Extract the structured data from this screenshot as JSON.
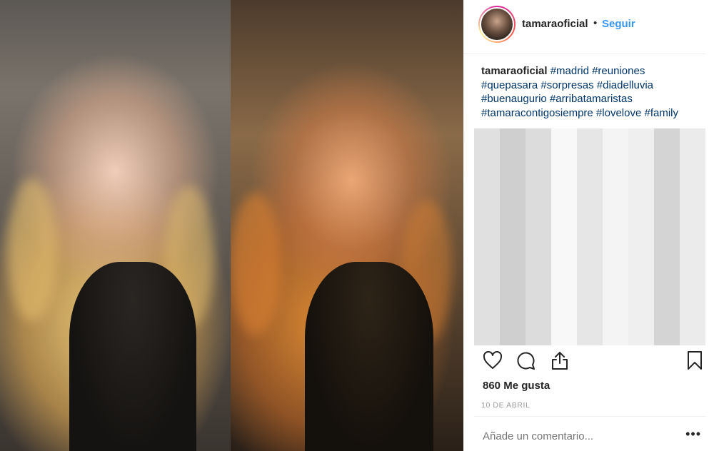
{
  "post": {
    "username": "tamaraoficial",
    "follow_separator": "•",
    "follow_label": "Seguir",
    "caption_user": "tamaraoficial",
    "hashtags": [
      "#madrid",
      "#reuniones",
      "#quepasara",
      "#sorpresas",
      "#diadelluvia",
      "#buenaugurio",
      "#arribatamaristas",
      "#tamaracontigosiempre",
      "#lovelove",
      "#family"
    ],
    "likes": "860 Me gusta",
    "date": "10 DE ABRIL",
    "comment_placeholder": "Añade un comentario...",
    "more_label": "•••"
  },
  "icons": {
    "like": "heart-icon",
    "comment": "comment-bubble-icon",
    "share": "share-icon",
    "save": "bookmark-icon",
    "more": "more-options-icon"
  },
  "colors": {
    "accent": "#3897f0",
    "hashtag": "#003569",
    "text": "#262626",
    "muted": "#999999"
  }
}
